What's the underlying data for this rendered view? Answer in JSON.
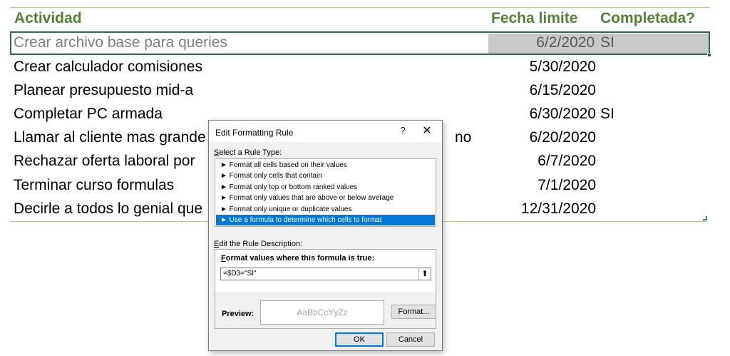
{
  "sheet": {
    "headers": {
      "actividad": "Actividad",
      "fecha": "Fecha limite",
      "completada": "Completada?"
    },
    "rows": [
      {
        "task": "Crear archivo base para queries",
        "date": "6/2/2020",
        "done": "SI"
      },
      {
        "task": "Crear calculador comisiones",
        "date": "5/30/2020",
        "done": ""
      },
      {
        "task": "Planear presupuesto mid-a",
        "date": "6/15/2020",
        "done": ""
      },
      {
        "task": "Completar PC armada",
        "date": "6/30/2020",
        "done": "SI"
      },
      {
        "task": "Llamar al cliente mas grande",
        "task_tail": "no",
        "date": "6/20/2020",
        "done": ""
      },
      {
        "task": "Rechazar oferta laboral por",
        "date": "6/7/2020",
        "done": ""
      },
      {
        "task": "Terminar curso formulas",
        "date": "7/1/2020",
        "done": ""
      },
      {
        "task": "Decirle a todos lo genial que",
        "date": "12/31/2020",
        "done": ""
      }
    ],
    "colors": {
      "header": "#538135",
      "selection": "#217346",
      "highlight": "#c8c8c8"
    }
  },
  "dialog": {
    "title": "Edit Formatting Rule",
    "help_icon": "?",
    "close_icon": "✕",
    "select_label_prefix": "S",
    "select_label_rest": "elect a Rule Type:",
    "rule_types": [
      "► Format all cells based on their values",
      "► Format only cells that contain",
      "► Format only top or bottom ranked values",
      "► Format only values that are above or below average",
      "► Format only unique or duplicate values",
      "► Use a formula to determine which cells to format"
    ],
    "selected_rule_index": 5,
    "edit_label_prefix": "E",
    "edit_label_rest": "dit the Rule Description:",
    "formula_label_prefix": "F",
    "formula_label_rest": "ormat values where this formula is true:",
    "formula_value": "=$D3=\"SI\"",
    "collapse_icon": "⬆",
    "preview_label": "Preview:",
    "preview_sample": "AaBbCcYyZz",
    "format_button": "Format...",
    "ok_button": "OK",
    "cancel_button": "Cancel",
    "accent": "#0078d7"
  }
}
